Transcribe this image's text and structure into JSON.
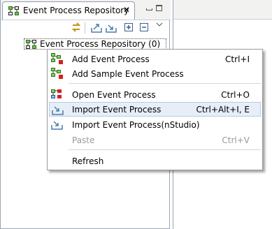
{
  "view": {
    "tab_title": "Event Process Repository",
    "close_glyph": "✕",
    "tree": {
      "root_label": "Event Process Repository (0)"
    }
  },
  "toolbar": {
    "icons": [
      "sync-icon",
      "export-icon",
      "import-icon",
      "expand-all-icon",
      "collapse-all-icon",
      "view-menu-icon"
    ]
  },
  "context_menu": {
    "items": [
      {
        "label": "Add Event Process",
        "shortcut": "Ctrl+I",
        "icon": "add-process-icon",
        "enabled": true
      },
      {
        "label": "Add Sample Event Process",
        "shortcut": "",
        "icon": "add-sample-icon",
        "enabled": true
      },
      {
        "label": "Open Event Process",
        "shortcut": "Ctrl+O",
        "icon": "open-process-icon",
        "enabled": true
      },
      {
        "label": "Import Event Process",
        "shortcut": "Ctrl+Alt+I, E",
        "icon": "import-icon",
        "enabled": true,
        "highlighted": true
      },
      {
        "label": "Import Event Process(nStudio)",
        "shortcut": "",
        "icon": "import-icon",
        "enabled": true
      },
      {
        "label": "Paste",
        "shortcut": "Ctrl+V",
        "icon": "",
        "enabled": false
      },
      {
        "label": "Refresh",
        "shortcut": "",
        "icon": "",
        "enabled": true
      }
    ]
  },
  "colors": {
    "highlight_bg": "#e7eef8",
    "highlight_border": "#b8cbe4",
    "disabled_text": "#9a9a9a",
    "icon_green": "#3a9a2a",
    "icon_red": "#d42020"
  }
}
